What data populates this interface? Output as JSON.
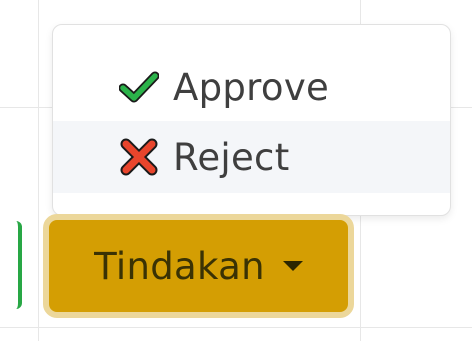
{
  "dropdown": {
    "items": [
      {
        "label": "Approve",
        "icon": "check-icon",
        "icon_color": "#2bb34a"
      },
      {
        "label": "Reject",
        "icon": "x-icon",
        "icon_color": "#e8452c"
      }
    ],
    "highlighted_item": "Reject"
  },
  "action_button": {
    "label": "Tindakan",
    "icon": "caret-down-icon",
    "background": "#d49e03",
    "focus_ring": "#ecd79a"
  }
}
